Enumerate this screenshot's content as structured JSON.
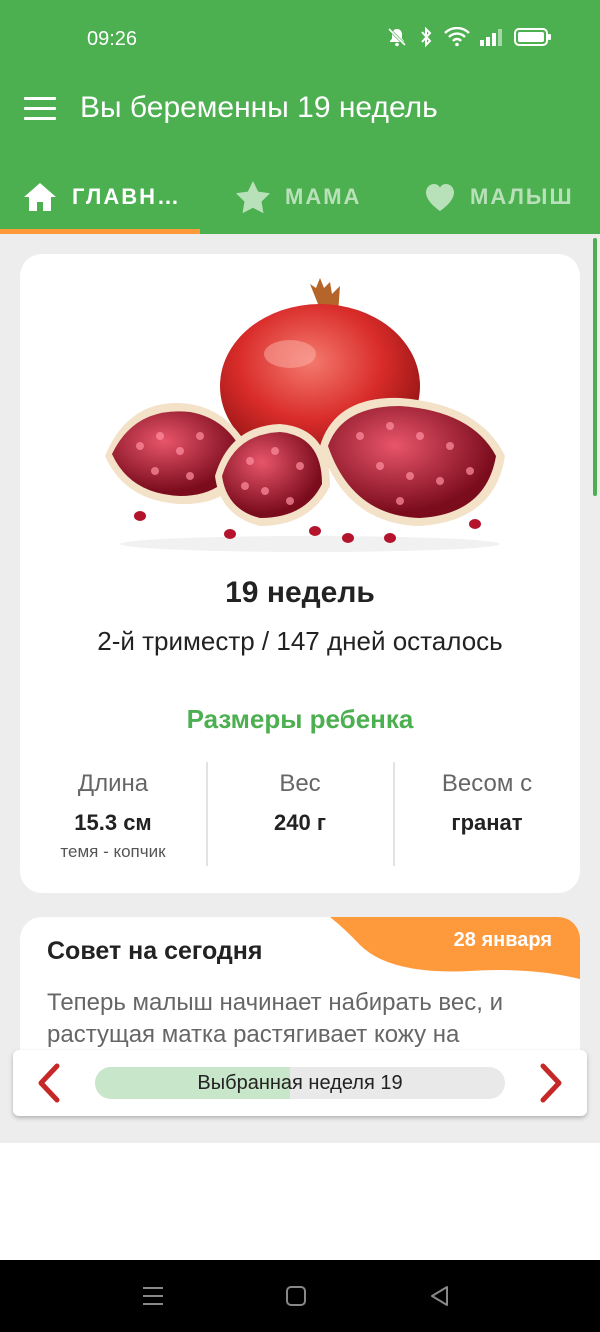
{
  "status_bar": {
    "time": "09:26"
  },
  "app_bar": {
    "title": "Вы беременны 19 недель"
  },
  "tabs": [
    {
      "label": "ГЛАВН…",
      "icon": "home-icon",
      "active": true
    },
    {
      "label": "МАМА",
      "icon": "star-icon",
      "active": false
    },
    {
      "label": "МАЛЫШ",
      "icon": "heart-icon",
      "active": false
    }
  ],
  "week_card": {
    "fruit_image": "pomegranate",
    "title": "19 недель",
    "subtitle": "2-й триместр / 147 дней осталось",
    "sizes_title": "Размеры ребенка",
    "stats": [
      {
        "label": "Длина",
        "value": "15.3 см",
        "note": "темя - копчик"
      },
      {
        "label": "Вес",
        "value": "240 г",
        "note": ""
      },
      {
        "label": "Весом с",
        "value": "гранат",
        "note": ""
      }
    ]
  },
  "tip": {
    "title": "Совет на сегодня",
    "date": "28 января",
    "text": "Теперь малыш начинает набирать вес, и растущая матка растягивает кожу на"
  },
  "week_selector": {
    "label": "Выбранная неделя 19",
    "progress": 0.475
  },
  "colors": {
    "primary": "#4caf50",
    "accent": "#ff9a3c",
    "arrow": "#c62828"
  }
}
